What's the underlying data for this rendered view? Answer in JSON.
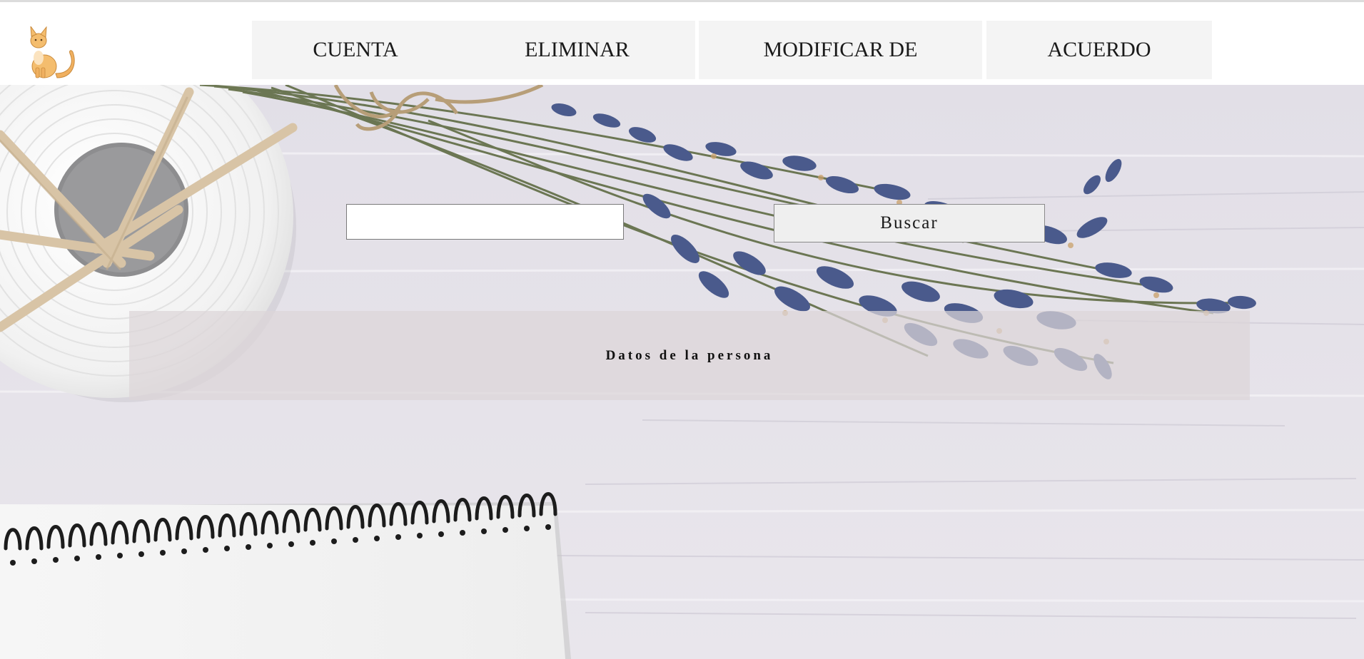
{
  "nav": {
    "items": [
      {
        "label": "CUENTA"
      },
      {
        "label": "ELIMINAR"
      },
      {
        "label": "MODIFICAR DE"
      },
      {
        "label": "ACUERDO"
      }
    ]
  },
  "logo": {
    "icon": "cat-icon"
  },
  "search": {
    "value": "",
    "placeholder": "",
    "button_label": "Buscar"
  },
  "panel": {
    "title": "Datos de la persona"
  },
  "colors": {
    "header_bg": "#ffffff",
    "nav_bg": "#f4f4f4",
    "background_wood": "#e4e1e8",
    "lavender": "#4a5a8c",
    "panel_bg": "#dcd6d8"
  }
}
